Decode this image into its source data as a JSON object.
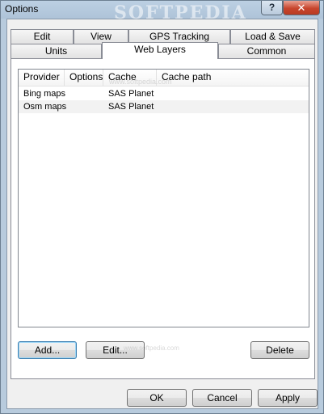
{
  "window": {
    "title": "Options",
    "help_label": "?",
    "close_label": "✕"
  },
  "tabs": {
    "row1": [
      "Edit",
      "View",
      "GPS Tracking",
      "Load & Save"
    ],
    "row2": [
      "Units",
      "Web Layers",
      "Common"
    ],
    "active": "Web Layers"
  },
  "list": {
    "columns": [
      "Provider",
      "Options",
      "Cache",
      "Cache path"
    ],
    "rows": [
      {
        "provider": "Bing maps",
        "options": "",
        "cache": "SAS Planet",
        "cache_path": ""
      },
      {
        "provider": "Osm maps",
        "options": "",
        "cache": "SAS Planet",
        "cache_path": ""
      }
    ]
  },
  "panel_buttons": {
    "add": "Add...",
    "edit": "Edit...",
    "delete": "Delete"
  },
  "dialog_buttons": {
    "ok": "OK",
    "cancel": "Cancel",
    "apply": "Apply"
  },
  "watermark": {
    "brand": "SOFTPEDIA",
    "url": "www.softpedia.com"
  }
}
